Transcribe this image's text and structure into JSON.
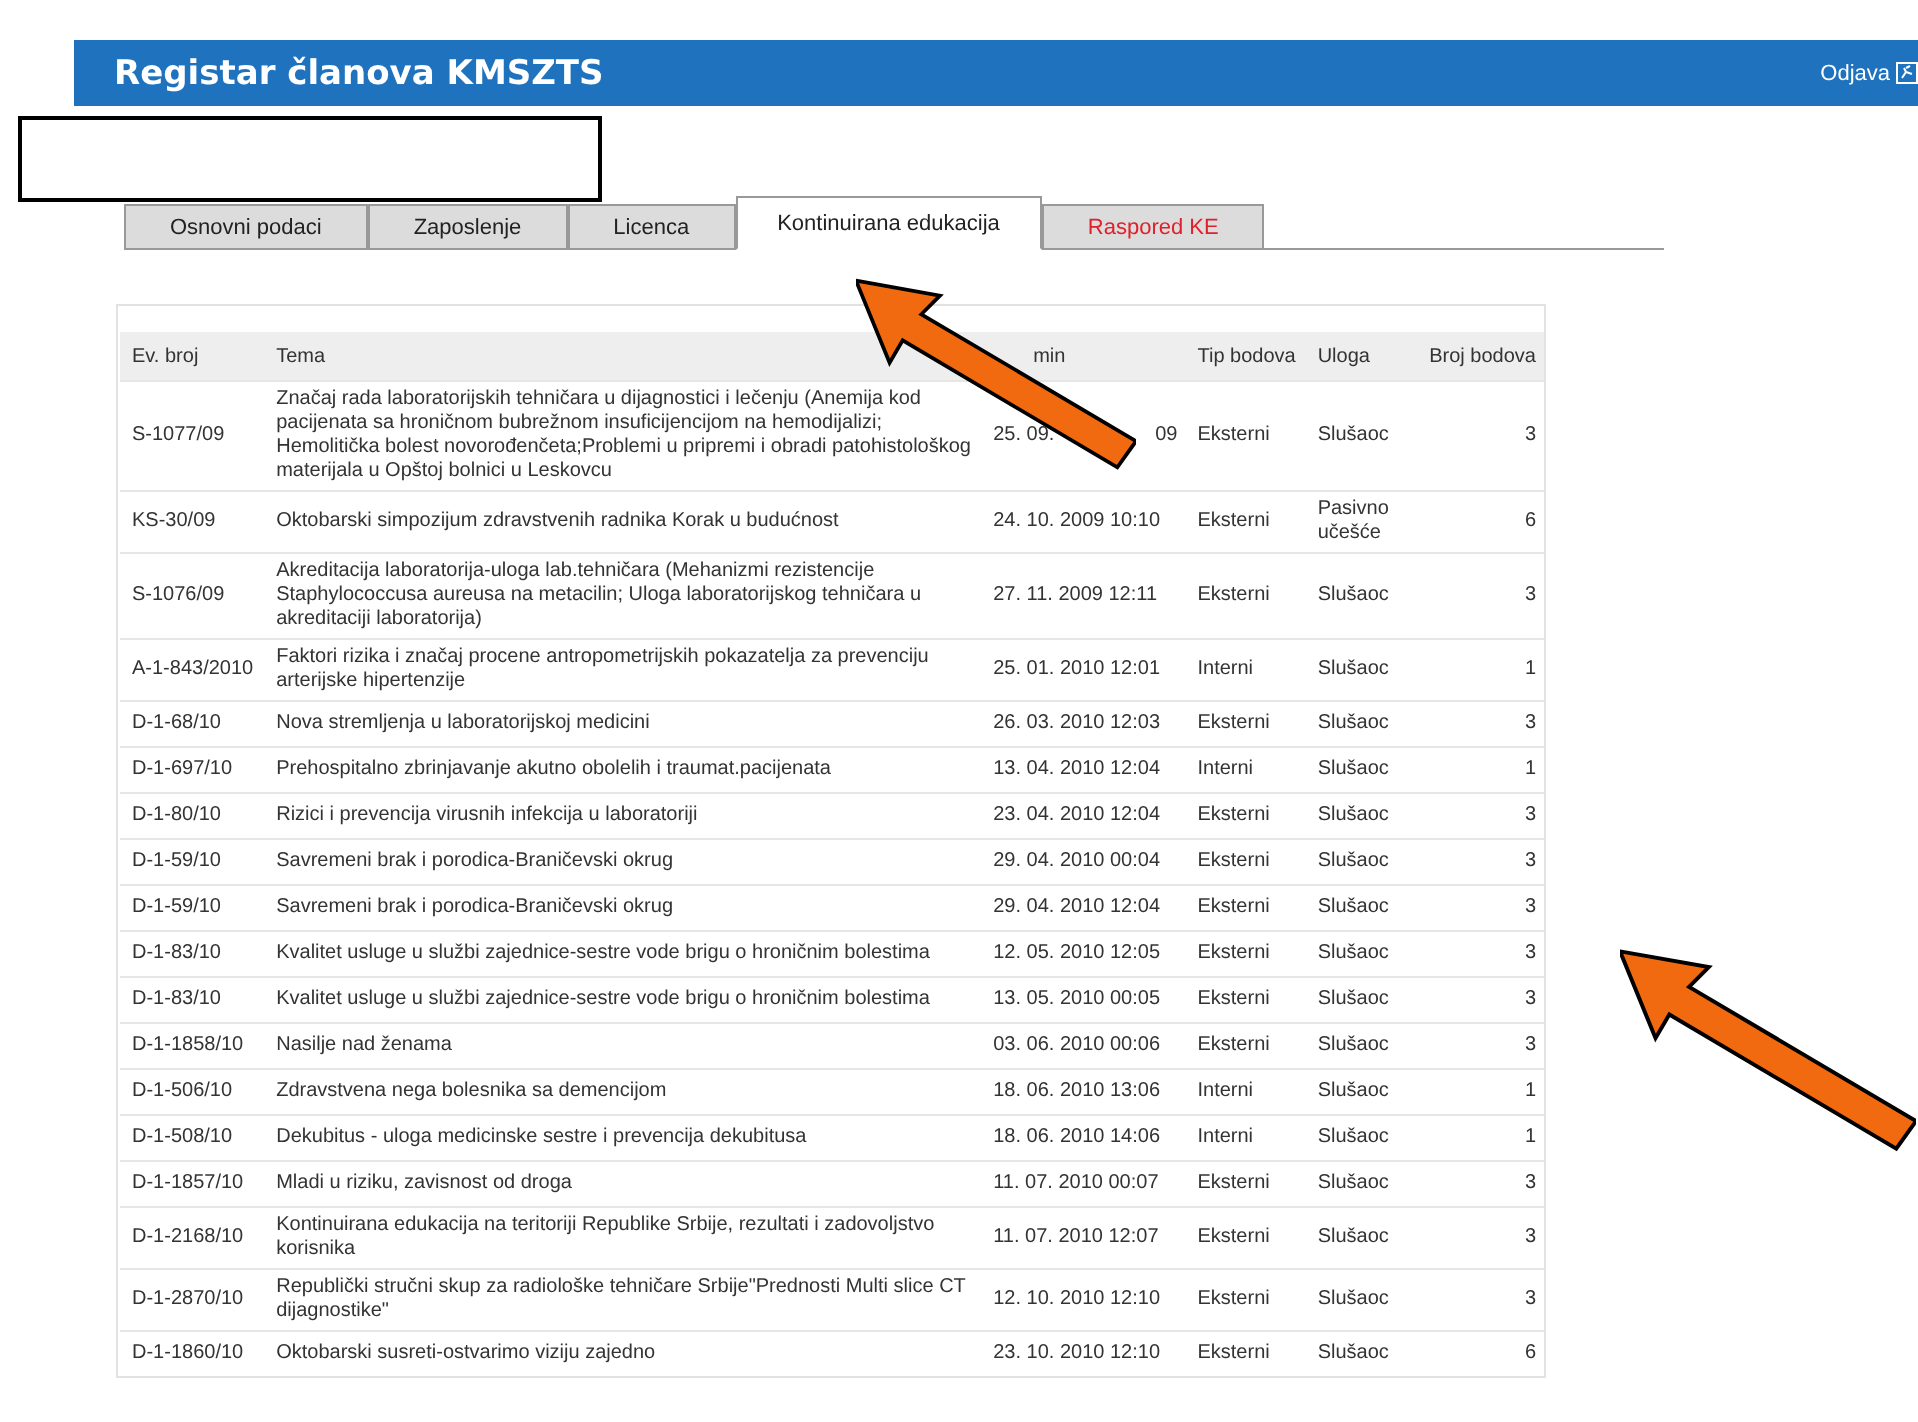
{
  "header": {
    "title": "Registar članova KMSZTS",
    "logout": "Odjava"
  },
  "tabs": [
    {
      "label": "Osnovni podaci",
      "selected": false,
      "kind": "normal"
    },
    {
      "label": "Zaposlenje",
      "selected": false,
      "kind": "normal"
    },
    {
      "label": "Licenca",
      "selected": false,
      "kind": "normal"
    },
    {
      "label": "Kontinuirana edukacija",
      "selected": true,
      "kind": "normal"
    },
    {
      "label": "Raspored KE",
      "selected": false,
      "kind": "alert"
    }
  ],
  "table": {
    "columns": [
      "Ev. broj",
      "Tema",
      "min",
      "Tip bodova",
      "Uloga",
      "Broj bodova"
    ],
    "rows": [
      {
        "ev": "S-1077/09",
        "tema": "Značaj rada laboratorijskih tehničara u dijagnostici i lečenju (Anemija kod pacijenata sa hroničnom bubrežnom insuficijencijom na hemodijalizi; Hemolitička bolest novorođenčeta;Problemi u pripremi i obradi patohistološkog materijala u Opštoj bolnici u Leskovcu",
        "termin": "25. 09.",
        "termin_tail": "09",
        "tip": "Eksterni",
        "uloga": "Slušaoc",
        "bodovi": "3"
      },
      {
        "ev": "KS-30/09",
        "tema": "Oktobarski simpozijum zdravstvenih radnika Korak u budućnost",
        "termin": "24. 10. 2009 10:10",
        "tip": "Eksterni",
        "uloga": "Pasivno učešće",
        "bodovi": "6"
      },
      {
        "ev": "S-1076/09",
        "tema": "Akreditacija laboratorija-uloga lab.tehničara (Mehanizmi rezistencije Staphylococcusa aureusa na metacilin; Uloga laboratorijskog tehničara u akreditaciji laboratorija)",
        "termin": "27. 11. 2009 12:11",
        "tip": "Eksterni",
        "uloga": "Slušaoc",
        "bodovi": "3"
      },
      {
        "ev": "A-1-843/2010",
        "tema": "Faktori rizika i značaj procene antropometrijskih pokazatelja za prevenciju arterijske hipertenzije",
        "termin": "25. 01. 2010 12:01",
        "tip": "Interni",
        "uloga": "Slušaoc",
        "bodovi": "1"
      },
      {
        "ev": "D-1-68/10",
        "tema": "Nova stremljenja u laboratorijskoj medicini",
        "termin": "26. 03. 2010 12:03",
        "tip": "Eksterni",
        "uloga": "Slušaoc",
        "bodovi": "3"
      },
      {
        "ev": "D-1-697/10",
        "tema": "Prehospitalno zbrinjavanje akutno obolelih i traumat.pacijenata",
        "termin": "13. 04. 2010 12:04",
        "tip": "Interni",
        "uloga": "Slušaoc",
        "bodovi": "1"
      },
      {
        "ev": "D-1-80/10",
        "tema": "Rizici i prevencija virusnih infekcija u laboratoriji",
        "termin": "23. 04. 2010 12:04",
        "tip": "Eksterni",
        "uloga": "Slušaoc",
        "bodovi": "3"
      },
      {
        "ev": "D-1-59/10",
        "tema": "Savremeni brak i porodica-Braničevski okrug",
        "termin": "29. 04. 2010 00:04",
        "tip": "Eksterni",
        "uloga": "Slušaoc",
        "bodovi": "3"
      },
      {
        "ev": "D-1-59/10",
        "tema": "Savremeni brak i porodica-Braničevski okrug",
        "termin": "29. 04. 2010 12:04",
        "tip": "Eksterni",
        "uloga": "Slušaoc",
        "bodovi": "3"
      },
      {
        "ev": "D-1-83/10",
        "tema": "Kvalitet usluge u službi zajednice-sestre vode brigu o hroničnim bolestima",
        "termin": "12. 05. 2010 12:05",
        "tip": "Eksterni",
        "uloga": "Slušaoc",
        "bodovi": "3"
      },
      {
        "ev": "D-1-83/10",
        "tema": "Kvalitet usluge u službi zajednice-sestre vode brigu o hroničnim bolestima",
        "termin": "13. 05. 2010 00:05",
        "tip": "Eksterni",
        "uloga": "Slušaoc",
        "bodovi": "3"
      },
      {
        "ev": "D-1-1858/10",
        "tema": "Nasilje nad ženama",
        "termin": "03. 06. 2010 00:06",
        "tip": "Eksterni",
        "uloga": "Slušaoc",
        "bodovi": "3"
      },
      {
        "ev": "D-1-506/10",
        "tema": "Zdravstvena nega bolesnika sa demencijom",
        "termin": "18. 06. 2010 13:06",
        "tip": "Interni",
        "uloga": "Slušaoc",
        "bodovi": "1"
      },
      {
        "ev": "D-1-508/10",
        "tema": "Dekubitus - uloga medicinske sestre i prevencija dekubitusa",
        "termin": "18. 06. 2010 14:06",
        "tip": "Interni",
        "uloga": "Slušaoc",
        "bodovi": "1"
      },
      {
        "ev": "D-1-1857/10",
        "tema": "Mladi u riziku, zavisnost od droga",
        "termin": "11. 07. 2010 00:07",
        "tip": "Eksterni",
        "uloga": "Slušaoc",
        "bodovi": "3"
      },
      {
        "ev": "D-1-2168/10",
        "tema": "Kontinuirana edukacija na teritoriji Republike Srbije, rezultati i zadovoljstvo korisnika",
        "termin": "11. 07. 2010 12:07",
        "tip": "Eksterni",
        "uloga": "Slušaoc",
        "bodovi": "3"
      },
      {
        "ev": "D-1-2870/10",
        "tema": "Republički stručni skup za radiološke tehničare Srbije\"Prednosti Multi slice CT dijagnostike\"",
        "termin": "12. 10. 2010 12:10",
        "tip": "Eksterni",
        "uloga": "Slušaoc",
        "bodovi": "3"
      },
      {
        "ev": "D-1-1860/10",
        "tema": "Oktobarski susreti-ostvarimo viziju zajedno",
        "termin": "23. 10. 2010 12:10",
        "tip": "Eksterni",
        "uloga": "Slušaoc",
        "bodovi": "6"
      }
    ]
  }
}
